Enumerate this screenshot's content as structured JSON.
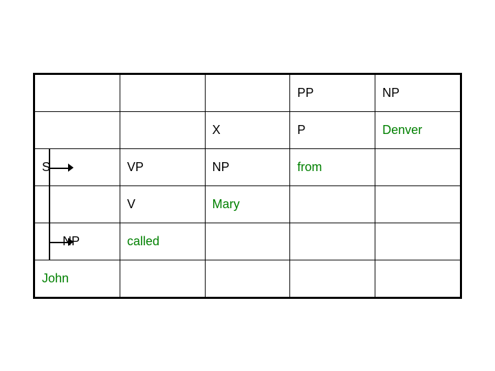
{
  "table": {
    "rows": [
      {
        "id": "row1",
        "cells": [
          {
            "id": "r1c1",
            "text": "",
            "color": "black",
            "type": "normal"
          },
          {
            "id": "r1c2",
            "text": "",
            "color": "black",
            "type": "normal"
          },
          {
            "id": "r1c3",
            "text": "",
            "color": "black",
            "type": "normal"
          },
          {
            "id": "r1c4",
            "text": "PP",
            "color": "black",
            "type": "normal"
          },
          {
            "id": "r1c5",
            "text": "NP",
            "color": "black",
            "type": "normal"
          }
        ]
      },
      {
        "id": "row2",
        "cells": [
          {
            "id": "r2c1",
            "text": "",
            "color": "black",
            "type": "normal"
          },
          {
            "id": "r2c2",
            "text": "",
            "color": "black",
            "type": "normal"
          },
          {
            "id": "r2c3",
            "text": "X",
            "color": "black",
            "type": "normal"
          },
          {
            "id": "r2c4",
            "text": "P",
            "color": "black",
            "type": "normal"
          },
          {
            "id": "r2c5",
            "text": "Denver",
            "color": "green",
            "type": "normal"
          }
        ]
      },
      {
        "id": "row3",
        "cells": [
          {
            "id": "r3c1",
            "text": "S",
            "color": "black",
            "type": "s-cell"
          },
          {
            "id": "r3c2",
            "text": "VP",
            "color": "black",
            "type": "normal"
          },
          {
            "id": "r3c3",
            "text": "NP",
            "color": "black",
            "type": "normal"
          },
          {
            "id": "r3c4",
            "text": "from",
            "color": "green",
            "type": "normal"
          },
          {
            "id": "r3c5",
            "text": "",
            "color": "black",
            "type": "normal"
          }
        ]
      },
      {
        "id": "row4",
        "cells": [
          {
            "id": "r4c1",
            "text": "",
            "color": "black",
            "type": "np-line-cell"
          },
          {
            "id": "r4c2",
            "text": "V",
            "color": "black",
            "type": "normal"
          },
          {
            "id": "r4c3",
            "text": "Mary",
            "color": "green",
            "type": "normal"
          },
          {
            "id": "r4c4",
            "text": "",
            "color": "black",
            "type": "normal"
          },
          {
            "id": "r4c5",
            "text": "",
            "color": "black",
            "type": "normal"
          }
        ]
      },
      {
        "id": "row5",
        "cells": [
          {
            "id": "r5c1",
            "text": "NP",
            "color": "black",
            "type": "np-line-cell"
          },
          {
            "id": "r5c2",
            "text": "called",
            "color": "green",
            "type": "normal"
          },
          {
            "id": "r5c3",
            "text": "",
            "color": "black",
            "type": "normal"
          },
          {
            "id": "r5c4",
            "text": "",
            "color": "black",
            "type": "normal"
          },
          {
            "id": "r5c5",
            "text": "",
            "color": "black",
            "type": "normal"
          }
        ]
      },
      {
        "id": "row6",
        "cells": [
          {
            "id": "r6c1",
            "text": "John",
            "color": "green",
            "type": "normal"
          },
          {
            "id": "r6c2",
            "text": "",
            "color": "black",
            "type": "normal"
          },
          {
            "id": "r6c3",
            "text": "",
            "color": "black",
            "type": "normal"
          },
          {
            "id": "r6c4",
            "text": "",
            "color": "black",
            "type": "normal"
          },
          {
            "id": "r6c5",
            "text": "",
            "color": "black",
            "type": "normal"
          }
        ]
      }
    ]
  }
}
